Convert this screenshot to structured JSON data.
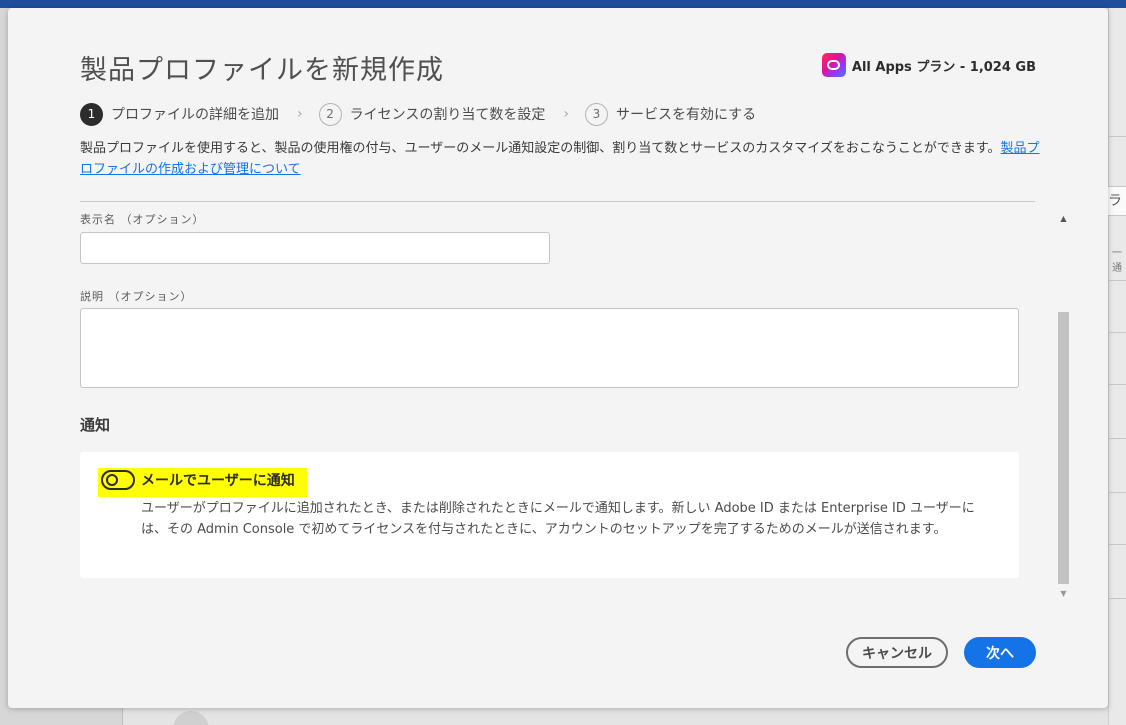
{
  "dialog": {
    "title": "製品プロファイルを新規作成",
    "plan_label": "All Apps プラン - 1,024 GB",
    "steps": [
      {
        "num": "1",
        "label": "プロファイルの詳細を追加"
      },
      {
        "num": "2",
        "label": "ライセンスの割り当て数を設定"
      },
      {
        "num": "3",
        "label": "サービスを有効にする"
      }
    ],
    "step_separator": "›",
    "intro_text": "製品プロファイルを使用すると、製品の使用権の付与、ユーザーのメール通知設定の制御、割り当て数とサービスのカスタマイズをおこなうことができます。",
    "intro_link": "製品プロファイルの作成および管理について",
    "display_name_label": "表示名 （オプション）",
    "display_name_value": "",
    "description_label": "説明 （オプション）",
    "description_value": "",
    "notifications_heading": "通知",
    "notify_toggle_label": "メールでユーザーに通知",
    "notify_toggle_on": false,
    "notify_description": "ユーザーがプロファイルに追加されたとき、または削除されたときにメールで通知します。新しい Adobe ID または Enterprise ID ユーザーには、その Admin Console で初めてライセンスを付与されたときに、アカウントのセットアップを完了するためのメールが送信されます。",
    "cancel_label": "キャンセル",
    "next_label": "次へ",
    "accent_color": "#1473e6"
  },
  "background": {
    "tab_text": "ライ",
    "side_text": "一通"
  },
  "icons": {
    "plan": "creative-cloud-icon",
    "scroll_up": "scroll-up-arrow-icon",
    "scroll_down": "scroll-down-arrow-icon"
  }
}
